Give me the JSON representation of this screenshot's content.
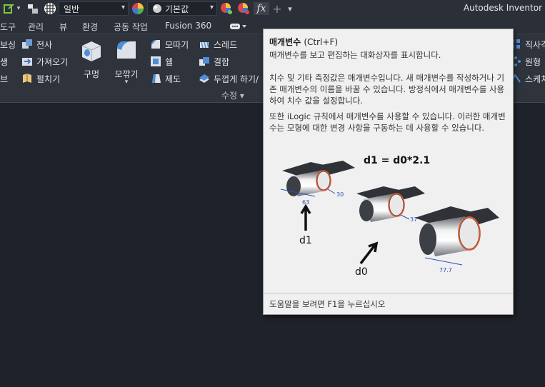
{
  "qat": {
    "style_dropdown": "일반",
    "appearance_dropdown": "기본값",
    "fx_label": "fx",
    "plus_label": "+",
    "more_label": "▾"
  },
  "app_title": "Autodesk Inventor",
  "tabs": [
    "도구",
    "관리",
    "뷰",
    "환경",
    "공동 작업",
    "Fusion 360"
  ],
  "ribbon": {
    "left_items": [
      "보싱",
      "생",
      "브"
    ],
    "col2": [
      "전사",
      "가져오기",
      "펼치기"
    ],
    "hole": "구멍",
    "chamfer_big": "모깎기",
    "col4": [
      "모따기",
      "쉘",
      "제도"
    ],
    "col5": [
      "스레드",
      "결합",
      "두껍게 하기/"
    ],
    "panel_label": "수정 ▾",
    "right_items": [
      "직사각",
      "원형",
      "스케치"
    ]
  },
  "tooltip": {
    "title": "매개변수",
    "shortcut": "(Ctrl+F)",
    "p1": "매개변수를 보고 편집하는 대화상자를 표시합니다.",
    "p2": "치수 및 기타 측정값은 매개변수입니다. 새 매개변수를 작성하거나 기존 매개변수의 이름을 바꿀 수 있습니다. 방정식에서 매개변수를 사용하여 치수 값을 설정합니다.",
    "p3": "또한 iLogic 규칙에서 매개변수를 사용할 수 있습니다. 이러한 매개변수는 모형에 대한 변경 사항을 구동하는 데 사용할 수 있습니다.",
    "equation": "d1 = d0*2.1",
    "label_d1": "d1",
    "label_d0": "d0",
    "dim_63": "63",
    "dim_30": "30",
    "dim_37": "37",
    "dim_777": "77.7",
    "footer": "도움말을 보려면 F1을 누르십시오"
  }
}
